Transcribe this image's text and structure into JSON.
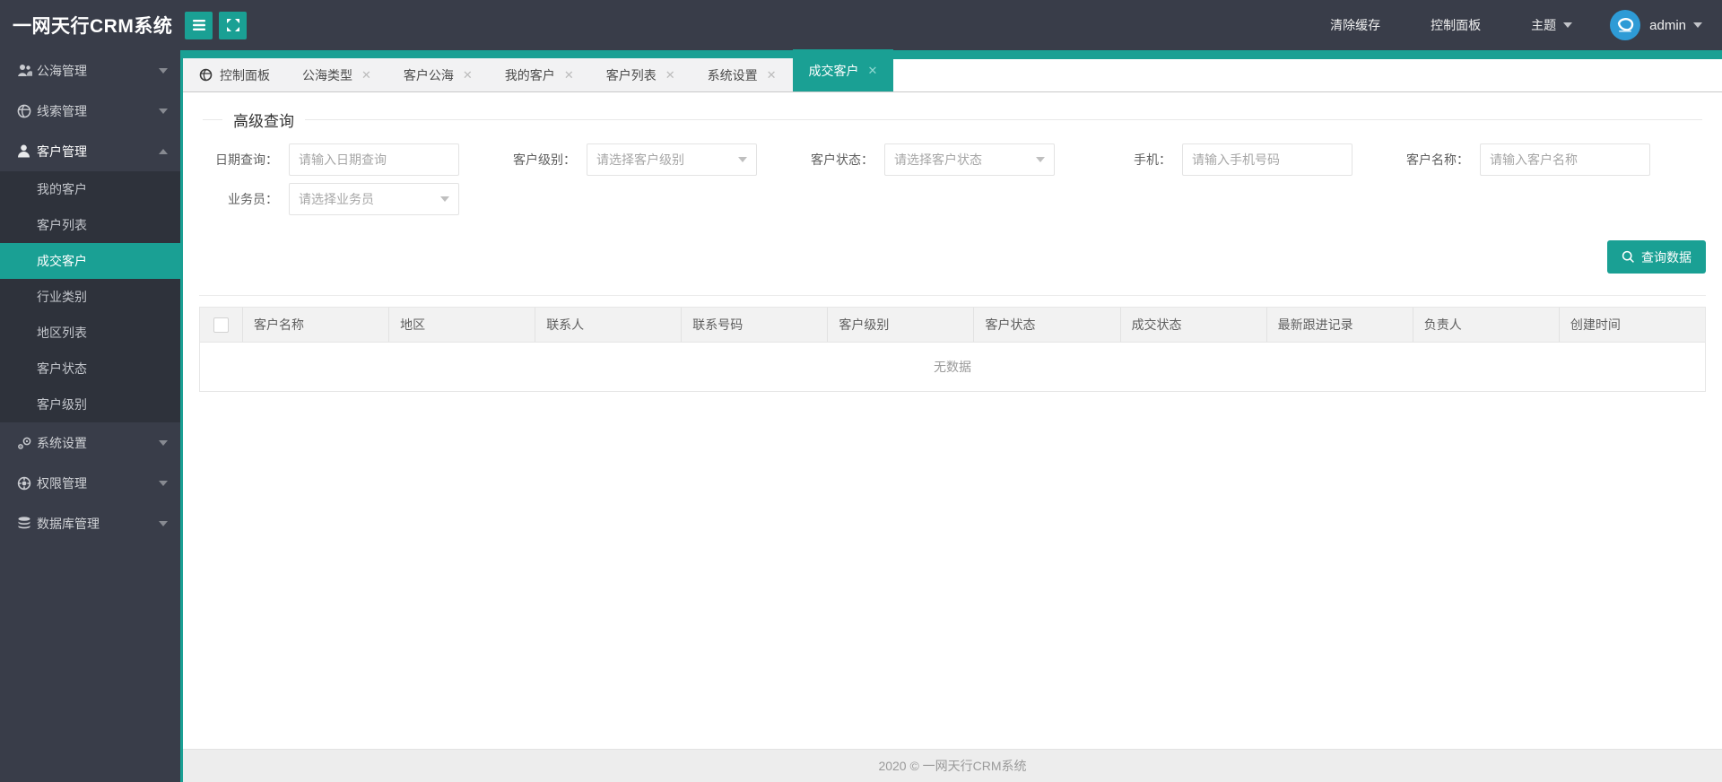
{
  "app": {
    "title": "一网天行CRM系统"
  },
  "header": {
    "clear_cache": "清除缓存",
    "control_panel": "控制面板",
    "theme": "主题",
    "username": "admin"
  },
  "sidebar": {
    "items": [
      {
        "label": "公海管理",
        "icon": "users-icon",
        "state": "collapsed"
      },
      {
        "label": "线索管理",
        "icon": "globe-icon",
        "state": "collapsed"
      },
      {
        "label": "客户管理",
        "icon": "user-icon",
        "state": "expanded",
        "children": [
          {
            "label": "我的客户"
          },
          {
            "label": "客户列表"
          },
          {
            "label": "成交客户",
            "active": true
          },
          {
            "label": "行业类别"
          },
          {
            "label": "地区列表"
          },
          {
            "label": "客户状态"
          },
          {
            "label": "客户级别"
          }
        ]
      },
      {
        "label": "系统设置",
        "icon": "gears-icon",
        "state": "collapsed"
      },
      {
        "label": "权限管理",
        "icon": "helm-icon",
        "state": "collapsed"
      },
      {
        "label": "数据库管理",
        "icon": "database-icon",
        "state": "collapsed"
      }
    ]
  },
  "tabs": [
    {
      "label": "控制面板",
      "icon": "globe-icon",
      "closable": false
    },
    {
      "label": "公海类型",
      "closable": true
    },
    {
      "label": "客户公海",
      "closable": true
    },
    {
      "label": "我的客户",
      "closable": true
    },
    {
      "label": "客户列表",
      "closable": true
    },
    {
      "label": "系统设置",
      "closable": true
    },
    {
      "label": "成交客户",
      "closable": true,
      "active": true
    }
  ],
  "tab_close_glyph": "✕",
  "query": {
    "legend": "高级查询",
    "fields": [
      {
        "label": "日期查询：",
        "placeholder": "请输入日期查询",
        "type": "input"
      },
      {
        "label": "客户级别：",
        "placeholder": "请选择客户级别",
        "type": "select"
      },
      {
        "label": "客户状态：",
        "placeholder": "请选择客户状态",
        "type": "select"
      },
      {
        "label": "手机：",
        "placeholder": "请输入手机号码",
        "type": "input"
      },
      {
        "label": "客户名称：",
        "placeholder": "请输入客户名称",
        "type": "input"
      },
      {
        "label": "业务员：",
        "placeholder": "请选择业务员",
        "type": "select"
      }
    ],
    "submit_label": "查询数据"
  },
  "table": {
    "columns": [
      "客户名称",
      "地区",
      "联系人",
      "联系号码",
      "客户级别",
      "客户状态",
      "成交状态",
      "最新跟进记录",
      "负责人",
      "创建时间"
    ],
    "empty_text": "无数据"
  },
  "footer": {
    "text": "2020 ©  一网天行CRM系统"
  },
  "colors": {
    "accent": "#1AA094",
    "header_bg": "#393D49",
    "submenu_bg": "#2E323B",
    "tab_strip_bg": "#F2F2F3",
    "table_header_bg": "#F2F2F2",
    "footer_bg": "#EDEDED",
    "avatar_blue": "#2E9BD6"
  }
}
